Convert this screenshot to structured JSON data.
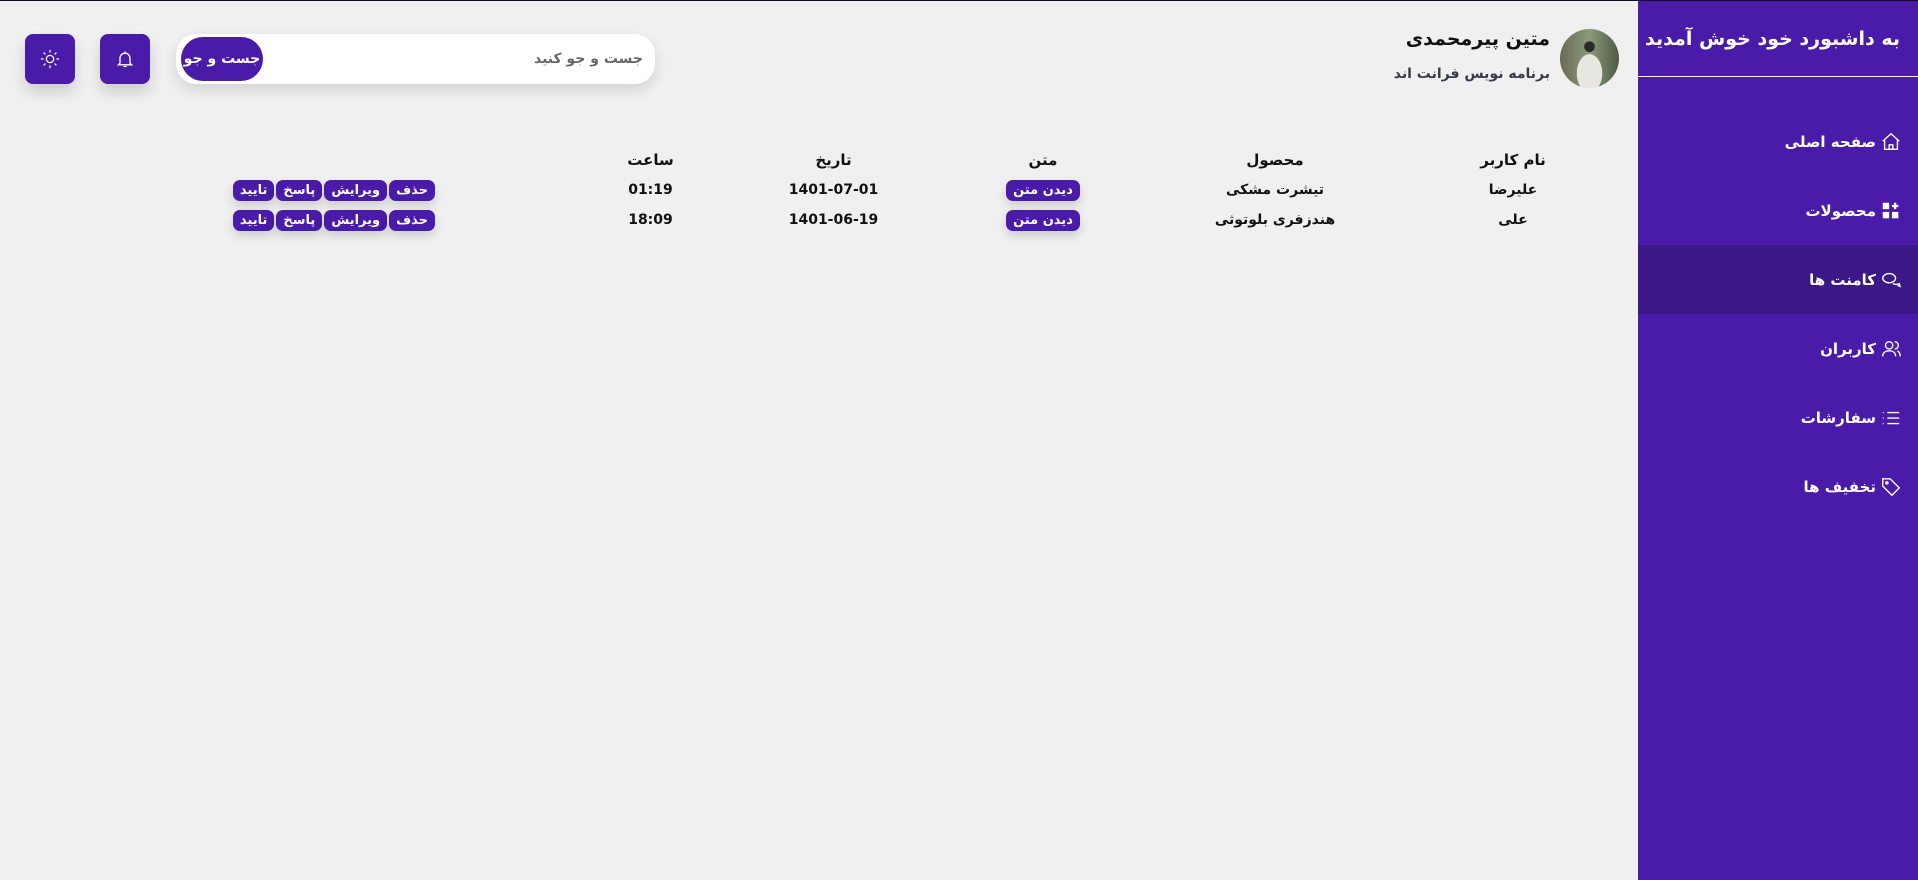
{
  "sidebar": {
    "title": "به داشبورد خود خوش آمدید",
    "items": [
      {
        "label": "صفحه اصلی",
        "icon": "home-icon"
      },
      {
        "label": "محصولات",
        "icon": "grid-icon"
      },
      {
        "label": "کامنت ها",
        "icon": "comments-icon",
        "active": true
      },
      {
        "label": "کاربران",
        "icon": "users-icon"
      },
      {
        "label": "سفارشات",
        "icon": "list-icon"
      },
      {
        "label": "تخفیف ها",
        "icon": "tag-icon"
      }
    ]
  },
  "header": {
    "user_name": "متین پیرمحمدی",
    "user_role": "برنامه نویس فرانت اند",
    "search_placeholder": "جست و جو کنید",
    "search_button": "جست و جو"
  },
  "table": {
    "headers": [
      "نام کاربر",
      "محصول",
      "متن",
      "تاریخ",
      "ساعت"
    ],
    "rows": [
      {
        "user": "علیرضا",
        "product": "تیشرت مشکی",
        "text_button": "دیدن متن",
        "date": "1401-07-01",
        "time": "01:19"
      },
      {
        "user": "علی",
        "product": "هندزفری بلوتوثی",
        "text_button": "دیدن متن",
        "date": "1401-06-19",
        "time": "18:09"
      }
    ],
    "actions": [
      "حذف",
      "ویرایش",
      "پاسخ",
      "تایید"
    ]
  },
  "colors": {
    "accent": "#4a1aa8",
    "active": "#3c1788",
    "background": "#f0f0f0"
  }
}
